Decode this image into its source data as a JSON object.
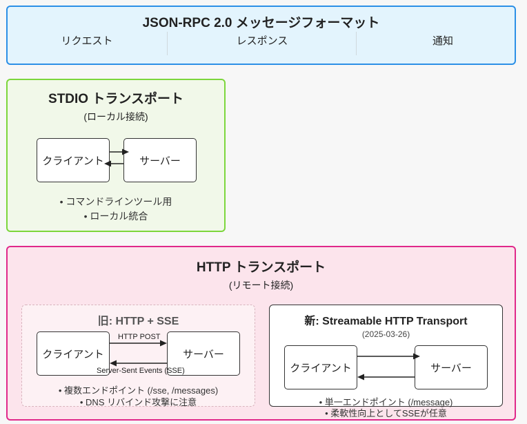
{
  "header": {
    "title": "JSON-RPC 2.0 メッセージフォーマット",
    "cols": [
      "リクエスト",
      "レスポンス",
      "通知"
    ]
  },
  "stdio": {
    "title": "STDIO トランスポート",
    "subtitle": "(ローカル接続)",
    "client": "クライアント",
    "server": "サーバー",
    "bullets": [
      "• コマンドラインツール用",
      "• ローカル統合"
    ]
  },
  "http": {
    "title": "HTTP トランスポート",
    "subtitle": "(リモート接続)",
    "old": {
      "title": "旧: HTTP + SSE",
      "client": "クライアント",
      "server": "サーバー",
      "label_post": "HTTP POST",
      "label_sse": "Server-Sent Events (SSE)",
      "bullets": [
        "• 複数エンドポイント (/sse, /messages)",
        "• DNS リバインド攻撃に注意"
      ]
    },
    "new": {
      "title": "新: Streamable HTTP Transport",
      "date": "(2025-03-26)",
      "client": "クライアント",
      "server": "サーバー",
      "bullets": [
        "• 単一エンドポイント (/message)",
        "• 柔軟性向上としてSSEが任意"
      ]
    }
  },
  "colors": {
    "header_bg": "#e3f2fd",
    "header_border": "#2196f3",
    "stdio_bg": "#f1f8e9",
    "stdio_border": "#7cd63c",
    "http_bg": "#fce4ec",
    "http_border": "#e91e8c"
  }
}
